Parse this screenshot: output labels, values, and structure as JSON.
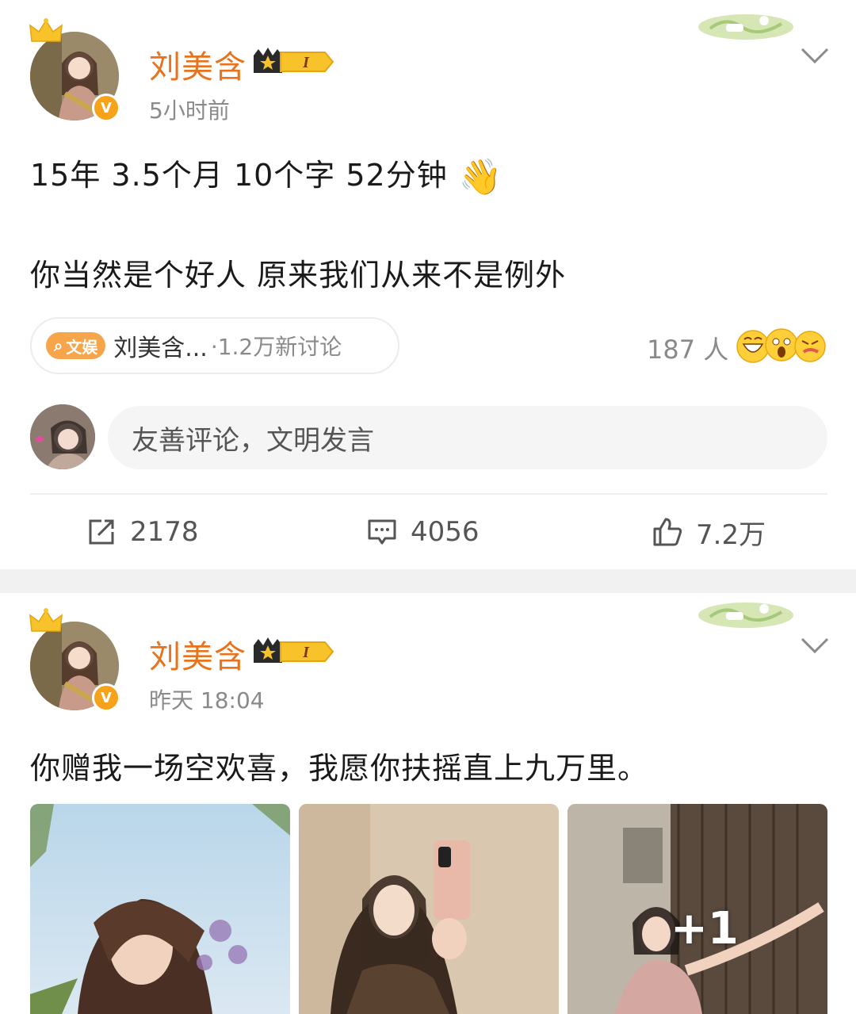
{
  "post1": {
    "username": "刘美含",
    "vip_level": "I",
    "time": "5小时前",
    "line1": "15年 3.5个月 10个字 52分钟",
    "wave_icon": "waving-hand-icon",
    "line2": "你当然是个好人   原来我们从来不是例外",
    "topic": {
      "tag": "文娱",
      "title": "刘美含...",
      "subtitle": "·1.2万新讨论"
    },
    "reactions": {
      "count": "187 人"
    },
    "comment_placeholder": "友善评论，文明发言",
    "actions": {
      "repost": "2178",
      "comment": "4056",
      "like": "7.2万"
    }
  },
  "post2": {
    "username": "刘美含",
    "vip_level": "I",
    "time": "昨天 18:04",
    "text": "你赠我一场空欢喜，我愿你扶摇直上九万里。",
    "more_photos": "+1"
  },
  "colors": {
    "username": "#e8731e",
    "verified": "#f7a21b",
    "muted": "#8a8a8a"
  }
}
